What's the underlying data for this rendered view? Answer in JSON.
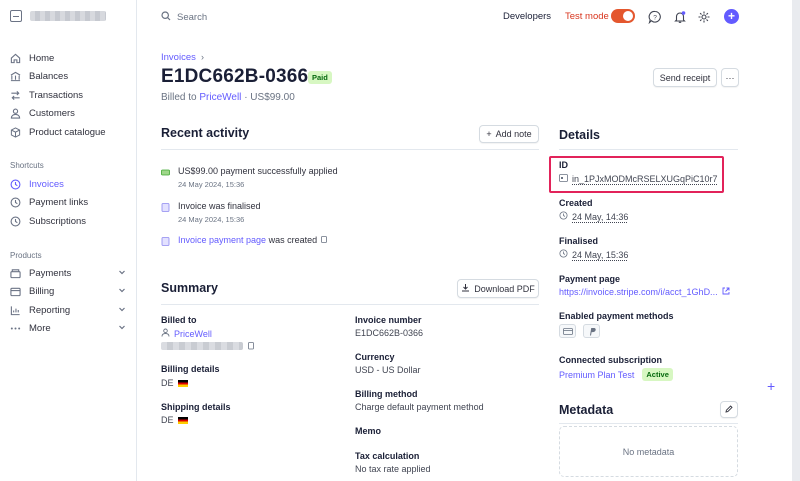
{
  "sidebar": {
    "nav": [
      {
        "label": "Home",
        "icon": "home-icon"
      },
      {
        "label": "Balances",
        "icon": "balances-icon"
      },
      {
        "label": "Transactions",
        "icon": "transactions-icon"
      },
      {
        "label": "Customers",
        "icon": "customers-icon"
      },
      {
        "label": "Product catalogue",
        "icon": "box-icon"
      }
    ],
    "shortcuts_title": "Shortcuts",
    "shortcuts": [
      {
        "label": "Invoices",
        "icon": "clock-icon",
        "active": true
      },
      {
        "label": "Payment links",
        "icon": "clock-icon"
      },
      {
        "label": "Subscriptions",
        "icon": "clock-icon"
      }
    ],
    "products_title": "Products",
    "products": [
      {
        "label": "Payments",
        "icon": "payments-icon"
      },
      {
        "label": "Billing",
        "icon": "billing-icon"
      },
      {
        "label": "Reporting",
        "icon": "reporting-icon"
      },
      {
        "label": "More",
        "icon": "more-icon"
      }
    ]
  },
  "topbar": {
    "search_placeholder": "Search",
    "developers": "Developers",
    "test_mode": "Test mode",
    "accent": "#635bff",
    "test_color": "#e4572e"
  },
  "invoice": {
    "breadcrumb": "Invoices",
    "number": "E1DC662B-0366",
    "status": "Paid",
    "billed_prefix": "Billed to",
    "customer": "PriceWell",
    "amount_suffix": "· US$99.00",
    "send_receipt": "Send receipt",
    "more": "···"
  },
  "activity": {
    "title": "Recent activity",
    "add_note": "Add note",
    "items": [
      {
        "text": "US$99.00 payment successfully applied",
        "date": "24 May 2024, 15:36"
      },
      {
        "text": "Invoice was finalised",
        "date": "24 May 2024, 15:36"
      },
      {
        "link": "Invoice payment page",
        "text": "was created"
      }
    ]
  },
  "summary": {
    "title": "Summary",
    "download": "Download PDF",
    "billed_to_label": "Billed to",
    "billed_to_value": "PriceWell",
    "billing_details_label": "Billing details",
    "billing_details_value": "DE",
    "shipping_details_label": "Shipping details",
    "shipping_details_value": "DE",
    "invoice_number_label": "Invoice number",
    "invoice_number_value": "E1DC662B-0366",
    "currency_label": "Currency",
    "currency_value": "USD - US Dollar",
    "billing_method_label": "Billing method",
    "billing_method_value": "Charge default payment method",
    "memo_label": "Memo",
    "tax_label": "Tax calculation",
    "tax_value": "No tax rate applied"
  },
  "details": {
    "title": "Details",
    "id_label": "ID",
    "id_value": "in_1PJxMODMcRSELXUGqPiC10r7",
    "created_label": "Created",
    "created_value": "24 May, 14:36",
    "finalised_label": "Finalised",
    "finalised_value": "24 May, 15:36",
    "payment_page_label": "Payment page",
    "payment_page_value": "https://invoice.stripe.com/i/acct_1GhD...",
    "methods_label": "Enabled payment methods",
    "subscription_label": "Connected subscription",
    "subscription_value": "Premium Plan Test",
    "subscription_status": "Active"
  },
  "metadata": {
    "title": "Metadata",
    "empty": "No metadata"
  }
}
